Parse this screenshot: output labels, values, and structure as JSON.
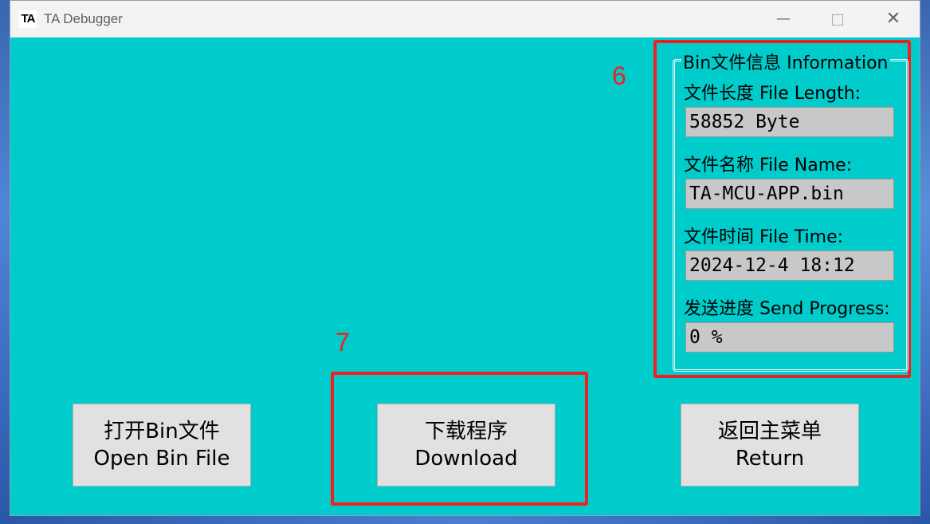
{
  "window": {
    "logo_text": "TA",
    "title": "TA Debugger",
    "minimize_glyph": "—",
    "close_glyph": "✕"
  },
  "annotations": {
    "callout_6": "6",
    "callout_7": "7",
    "highlight_color": "#f02020"
  },
  "bin_info": {
    "title": "Bin文件信息 Information",
    "fields": [
      {
        "label": "文件长度 File Length:",
        "value": "58852 Byte"
      },
      {
        "label": "文件名称 File Name:",
        "value": "TA-MCU-APP.bin"
      },
      {
        "label": "文件时间 File Time:",
        "value": "2024-12-4 18:12"
      },
      {
        "label": "发送进度 Send Progress:",
        "value": "0 %"
      }
    ]
  },
  "buttons": {
    "open": {
      "line1": "打开Bin文件",
      "line2": "Open Bin File"
    },
    "download": {
      "line1": "下载程序",
      "line2": "Download"
    },
    "return": {
      "line1": "返回主菜单",
      "line2": "Return"
    }
  },
  "colors": {
    "client_bg": "#00cccc",
    "button_bg": "#e1e1e1",
    "field_bg": "#c8c8c8"
  },
  "icons": [
    "app-logo-icon",
    "minimize-icon",
    "maximize-icon",
    "close-icon"
  ]
}
